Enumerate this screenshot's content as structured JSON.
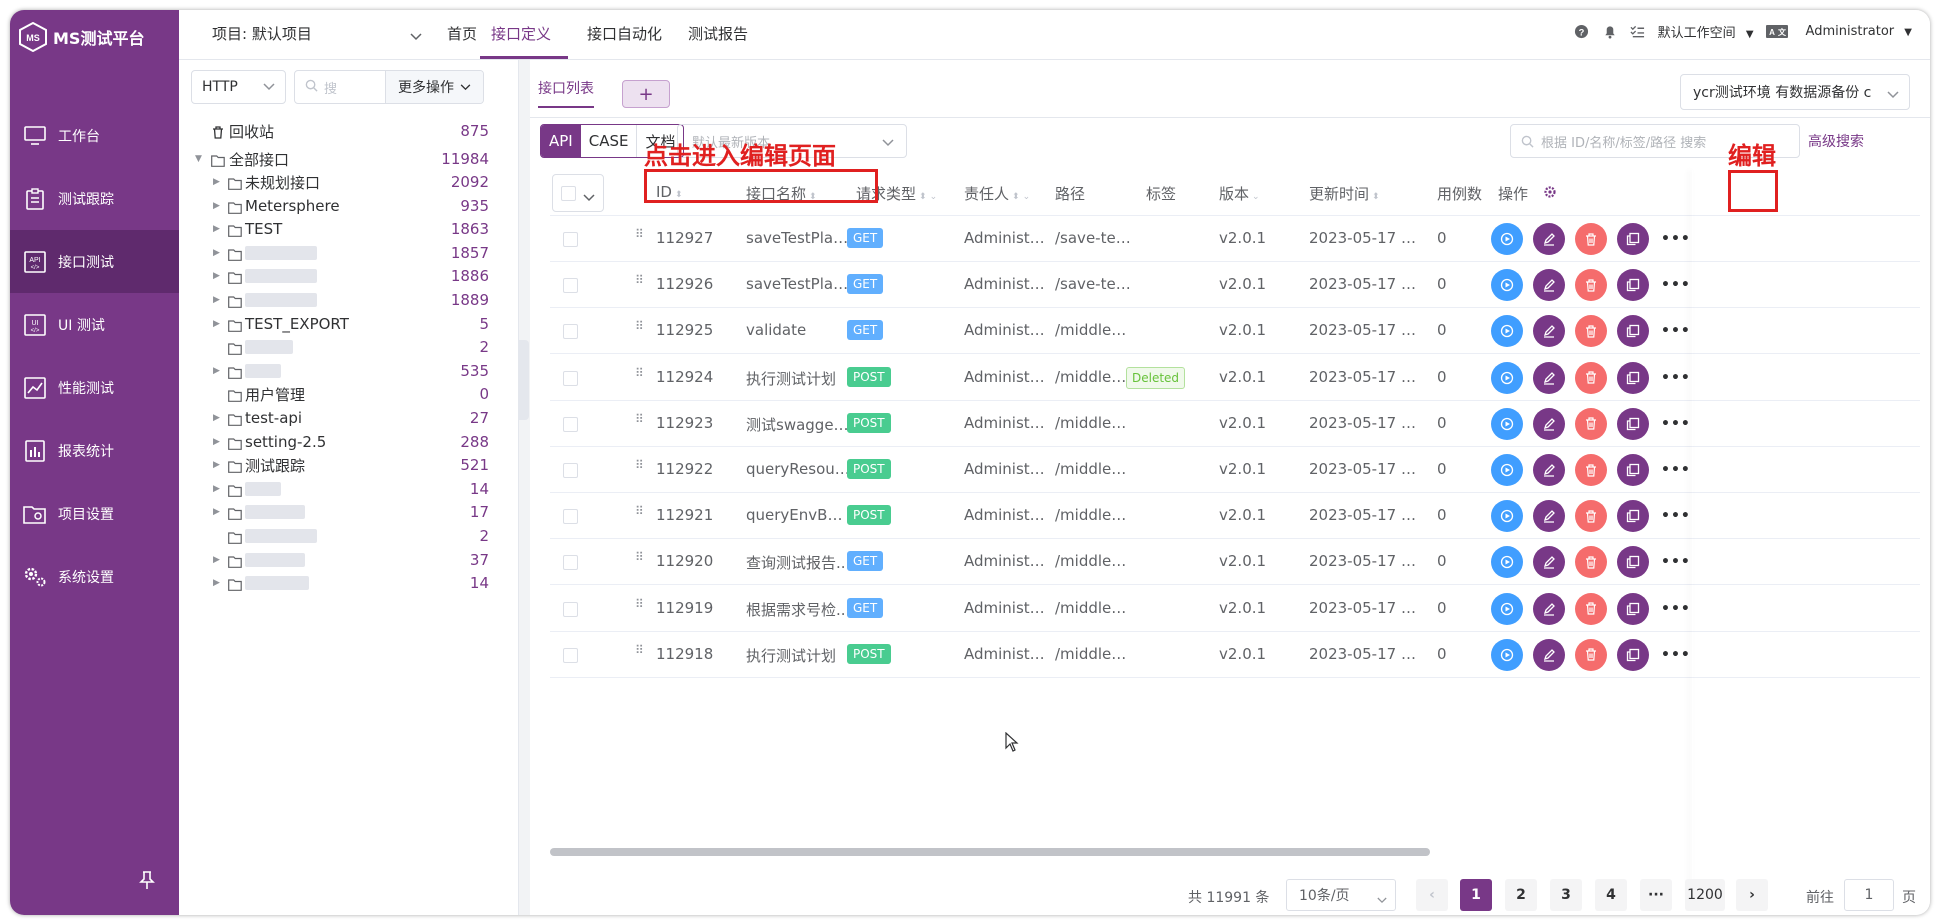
{
  "app": {
    "logo_text": "MS测试平台"
  },
  "sidebar": {
    "items": [
      {
        "label": "工作台",
        "icon": "monitor-icon"
      },
      {
        "label": "测试跟踪",
        "icon": "clipboard-icon"
      },
      {
        "label": "接口测试",
        "icon": "api-icon",
        "active": true
      },
      {
        "label": "UI 测试",
        "icon": "ui-icon"
      },
      {
        "label": "性能测试",
        "icon": "chart-icon"
      },
      {
        "label": "报表统计",
        "icon": "report-icon"
      },
      {
        "label": "项目设置",
        "icon": "folder-settings-icon"
      },
      {
        "label": "系统设置",
        "icon": "gears-icon"
      }
    ]
  },
  "header": {
    "project_label": "项目: 默认项目",
    "nav": [
      "首页",
      "接口定义",
      "接口自动化",
      "测试报告"
    ],
    "workspace": "默认工作空间",
    "user": "Administrator"
  },
  "left_panel": {
    "protocol": "HTTP",
    "search_placeholder": "搜",
    "more_ops": "更多操作",
    "recycle_label": "回收站",
    "recycle_count": "875",
    "root_label": "全部接口",
    "root_count": "11984",
    "nodes": [
      {
        "label": "未规划接口",
        "count": "2092",
        "caret": true
      },
      {
        "label": "Metersphere",
        "count": "935",
        "caret": true
      },
      {
        "label": "TEST",
        "count": "1863",
        "caret": true
      },
      {
        "label": "",
        "count": "1857",
        "caret": true
      },
      {
        "label": "",
        "count": "1886",
        "caret": true
      },
      {
        "label": "",
        "count": "1889",
        "caret": true
      },
      {
        "label": "TEST_EXPORT",
        "count": "5",
        "caret": true
      },
      {
        "label": "",
        "count": "2",
        "caret": false
      },
      {
        "label": "",
        "count": "535",
        "caret": true
      },
      {
        "label": "用户管理",
        "count": "0",
        "caret": false
      },
      {
        "label": "test-api",
        "count": "27",
        "caret": true
      },
      {
        "label": "setting-2.5",
        "count": "288",
        "caret": true
      },
      {
        "label": "测试跟踪",
        "count": "521",
        "caret": true
      },
      {
        "label": "",
        "count": "14",
        "caret": true
      },
      {
        "label": "",
        "count": "17",
        "caret": true
      },
      {
        "label": "",
        "count": "2",
        "caret": false
      },
      {
        "label": "",
        "count": "37",
        "caret": true
      },
      {
        "label": "",
        "count": "14",
        "caret": true
      }
    ]
  },
  "main": {
    "tab_list": "接口列表",
    "tab_add": "+",
    "env": "ycr测试环境 有数据源备份 c",
    "modes": [
      "API",
      "CASE",
      "文档"
    ],
    "version_placeholder": "默认最新版本",
    "search_placeholder": "根据 ID/名称/标签/路径 搜索",
    "advanced_search": "高级搜索",
    "columns": {
      "id": "ID",
      "name": "接口名称",
      "method": "请求类型",
      "owner": "责任人",
      "path": "路径",
      "tag": "标签",
      "version": "版本",
      "updated": "更新时间",
      "cases": "用例数",
      "ops": "操作"
    },
    "rows": [
      {
        "id": "112927",
        "name": "saveTestPlan...",
        "method": "GET",
        "owner": "Administr...",
        "path": "/save-test-...",
        "tag": "",
        "version": "v2.0.1",
        "updated": "2023-05-17 17:2...",
        "cases": "0"
      },
      {
        "id": "112926",
        "name": "saveTestPlan...",
        "method": "GET",
        "owner": "Administr...",
        "path": "/save-test-...",
        "tag": "",
        "version": "v2.0.1",
        "updated": "2023-05-17 17:2...",
        "cases": "0"
      },
      {
        "id": "112925",
        "name": "validate",
        "method": "GET",
        "owner": "Administr...",
        "path": "/middlewa...",
        "tag": "",
        "version": "v2.0.1",
        "updated": "2023-05-17 17:2...",
        "cases": "0"
      },
      {
        "id": "112924",
        "name": "执行测试计划",
        "method": "POST",
        "owner": "Administr...",
        "path": "/middlewa...",
        "tag": "Deleted",
        "version": "v2.0.1",
        "updated": "2023-05-17 17:2...",
        "cases": "0"
      },
      {
        "id": "112923",
        "name": "测试swagger...",
        "method": "POST",
        "owner": "Administr...",
        "path": "/middlewa...",
        "tag": "",
        "version": "v2.0.1",
        "updated": "2023-05-17 17:2...",
        "cases": "0"
      },
      {
        "id": "112922",
        "name": "queryResour...",
        "method": "POST",
        "owner": "Administr...",
        "path": "/middlewa...",
        "tag": "",
        "version": "v2.0.1",
        "updated": "2023-05-17 17:2...",
        "cases": "0"
      },
      {
        "id": "112921",
        "name": "queryEnvByP...",
        "method": "POST",
        "owner": "Administr...",
        "path": "/middlewa...",
        "tag": "",
        "version": "v2.0.1",
        "updated": "2023-05-17 17:2...",
        "cases": "0"
      },
      {
        "id": "112920",
        "name": "查询测试报告...",
        "method": "GET",
        "owner": "Administr...",
        "path": "/middlewa...",
        "tag": "",
        "version": "v2.0.1",
        "updated": "2023-05-17 17:2...",
        "cases": "0"
      },
      {
        "id": "112919",
        "name": "根据需求号检...",
        "method": "GET",
        "owner": "Administr...",
        "path": "/middlewa...",
        "tag": "",
        "version": "v2.0.1",
        "updated": "2023-05-17 17:2...",
        "cases": "0"
      },
      {
        "id": "112918",
        "name": "执行测试计划",
        "method": "POST",
        "owner": "Administr...",
        "path": "/middlewa...",
        "tag": "",
        "version": "v2.0.1",
        "updated": "2023-05-17 17:2...",
        "cases": "0"
      }
    ],
    "pagination": {
      "total": "共 11991 条",
      "page_size": "10条/页",
      "pages": [
        "1",
        "2",
        "3",
        "4",
        "···",
        "1200"
      ],
      "goto_prefix": "前往",
      "goto_value": "1",
      "goto_suffix": "页"
    }
  },
  "annotations": {
    "click_to_edit": "点击进入编辑页面",
    "edit": "编辑"
  },
  "colors": {
    "brand": "#783887",
    "get": "#61affe",
    "post": "#49cc90",
    "run": "#409eff",
    "delete": "#f56c6c"
  }
}
